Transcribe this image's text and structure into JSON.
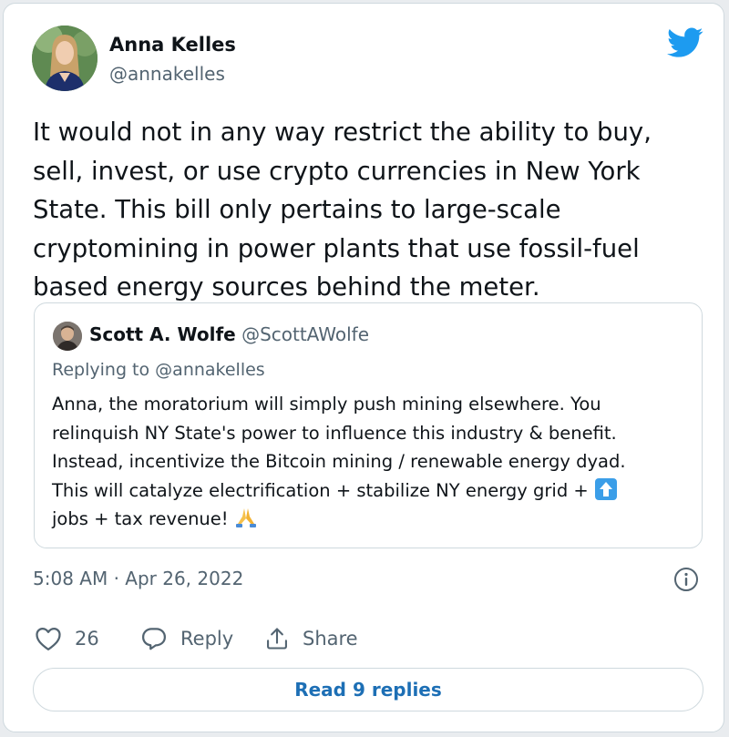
{
  "colors": {
    "twitter_blue": "#1d9bf0",
    "link": "#1d6fb5",
    "text": "#0f1419",
    "secondary": "#536471",
    "border": "#cfd9de"
  },
  "tweet": {
    "author": {
      "name": "Anna Kelles",
      "handle": "@annakelles"
    },
    "brand_icon": "twitter-bird-icon",
    "text": "It would not in any way restrict the ability to buy,\nsell, invest, or use crypto currencies in New York\nState. This bill only pertains to large-scale\ncryptomining in power plants that use fossil-fuel\nbased energy sources behind the meter.",
    "quoted": {
      "name": "Scott A. Wolfe",
      "handle": "@ScottAWolfe",
      "replying_prefix": "Replying to",
      "replying_handle": "@annakelles",
      "text": "Anna, the moratorium will simply push mining elsewhere. You\nrelinquish NY State's power to influence this industry & benefit.\nInstead, incentivize the Bitcoin mining / renewable energy dyad.\nThis will catalyze electrification + stabilize NY energy grid +",
      "text_line2": "jobs + tax revenue!",
      "emoji_up": "up-arrow-emoji-icon",
      "emoji_pray": "folded-hands-emoji-icon"
    },
    "timestamp": "5:08 AM · Apr 26, 2022",
    "info_icon": "info-icon",
    "actions": {
      "likes": "26",
      "reply_label": "Reply",
      "share_label": "Share"
    },
    "read_replies_label": "Read 9 replies"
  }
}
